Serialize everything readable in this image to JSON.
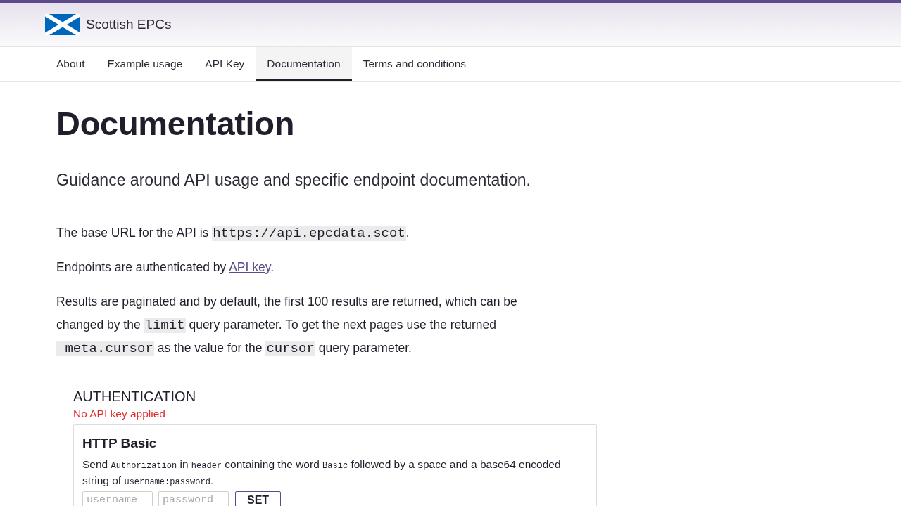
{
  "header": {
    "title": "Scottish EPCs"
  },
  "nav": {
    "tabs": [
      {
        "label": "About",
        "selected": false
      },
      {
        "label": "Example usage",
        "selected": false
      },
      {
        "label": "API Key",
        "selected": false
      },
      {
        "label": "Documentation",
        "selected": true
      },
      {
        "label": "Terms and conditions",
        "selected": false
      }
    ]
  },
  "page": {
    "title": "Documentation",
    "subtitle": "Guidance around API usage and specific endpoint documentation."
  },
  "paragraphs": [
    {
      "segments": [
        {
          "kind": "text",
          "text": "The base URL for the API is "
        },
        {
          "kind": "code",
          "text": "https://api.epcdata.scot"
        },
        {
          "kind": "text",
          "text": "."
        }
      ]
    },
    {
      "segments": [
        {
          "kind": "text",
          "text": "Endpoints are authenticated by "
        },
        {
          "kind": "link",
          "text": "API key"
        },
        {
          "kind": "text",
          "text": "."
        }
      ]
    },
    {
      "segments": [
        {
          "kind": "text",
          "text": "Results are paginated and by default, the first 100 results are returned, which can be changed by the "
        },
        {
          "kind": "code",
          "text": "limit"
        },
        {
          "kind": "text",
          "text": " query parameter. To get the next pages use the returned "
        },
        {
          "kind": "code",
          "text": "_meta.cursor"
        },
        {
          "kind": "text",
          "text": " as the value for the "
        },
        {
          "kind": "code",
          "text": "cursor"
        },
        {
          "kind": "text",
          "text": " query parameter."
        }
      ]
    }
  ],
  "authentication": {
    "heading": "AUTHENTICATION",
    "status": "No API key applied",
    "schemes": [
      {
        "title": "HTTP Basic",
        "description": [
          {
            "kind": "text",
            "text": "Send "
          },
          {
            "kind": "code",
            "text": "Authorization"
          },
          {
            "kind": "text",
            "text": " in "
          },
          {
            "kind": "code",
            "text": "header"
          },
          {
            "kind": "text",
            "text": " containing the word "
          },
          {
            "kind": "code",
            "text": "Basic"
          },
          {
            "kind": "text",
            "text": " followed by a space and a base64 encoded string of "
          },
          {
            "kind": "code",
            "text": "username:password"
          },
          {
            "kind": "text",
            "text": "."
          }
        ],
        "fields": [
          {
            "placeholder": "username"
          },
          {
            "placeholder": "password"
          }
        ],
        "button": "SET"
      }
    ]
  }
}
